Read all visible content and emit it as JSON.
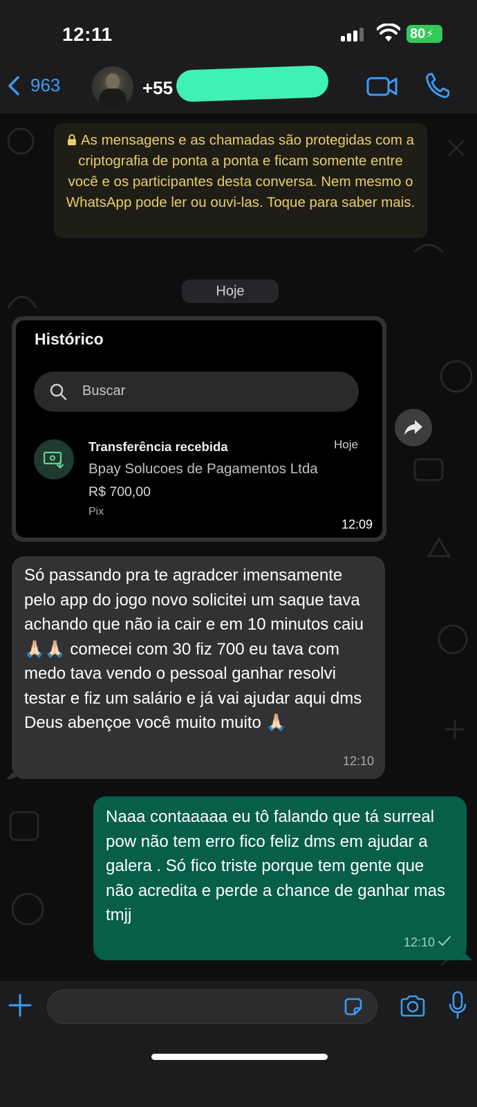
{
  "status_bar": {
    "time": "12:11",
    "battery": "80",
    "battery_color": "#34c759"
  },
  "header": {
    "back_count": "963",
    "contact_name": "+55",
    "accent_color": "#3a9cf5",
    "icons": [
      "chevron-left-icon",
      "video-call-icon",
      "phone-icon"
    ]
  },
  "encryption_notice": "As mensagens e as chamadas são protegidas com a criptografia de ponta a ponta e ficam somente entre você e os participantes desta conversa. Nem mesmo o WhatsApp pode ler ou ouvi-las. Toque para saber mais.",
  "date_separator": "Hoje",
  "image_message": {
    "screen_title": "Histórico",
    "search_placeholder": "Buscar",
    "transaction": {
      "title": "Transferência recebida",
      "date": "Hoje",
      "company": "Bpay Solucoes de Pagamentos Ltda",
      "amount": "R$ 700,00",
      "method": "Pix"
    },
    "time": "12:09"
  },
  "messages": [
    {
      "direction": "incoming",
      "text": "Só passando pra te agradcer imensamente pelo app do jogo novo solicitei um saque tava achando que não ia cair e em 10 minutos caiu 🙏🏻🙏🏻 comecei com 30 fiz 700 eu tava com medo tava vendo o pessoal ganhar resolvi testar e fiz um salário e já vai ajudar aqui dms Deus abençoe você muito muito 🙏🏻",
      "time": "12:10"
    },
    {
      "direction": "outgoing",
      "text": "Naaa contaaaaa eu tô falando que tá surreal pow não tem erro fico feliz dms em ajudar a galera . Só fico triste porque tem gente que não acredita e perde a chance de ganhar mas tmjj",
      "time": "12:10",
      "status": "sent"
    }
  ],
  "input_bar": {
    "placeholder": "",
    "icons": [
      "plus-icon",
      "sticker-icon",
      "camera-icon",
      "microphone-icon"
    ]
  }
}
